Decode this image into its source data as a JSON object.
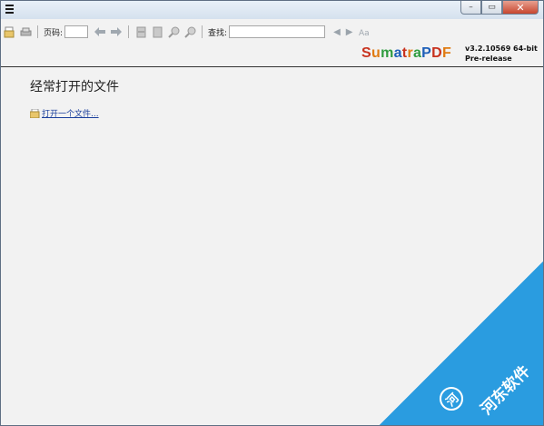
{
  "window": {
    "controls": {
      "minimize": "–",
      "maximize": "▭",
      "close": "✕"
    }
  },
  "toolbar": {
    "page_label": "页码:",
    "find_label": "查找:"
  },
  "app": {
    "name_parts": [
      {
        "text": "S",
        "color": "#c8321e"
      },
      {
        "text": "u",
        "color": "#e07b12"
      },
      {
        "text": "m",
        "color": "#2f9c3f"
      },
      {
        "text": "a",
        "color": "#1d5fb8"
      },
      {
        "text": "t",
        "color": "#c8321e"
      },
      {
        "text": "r",
        "color": "#e07b12"
      },
      {
        "text": "a",
        "color": "#2f9c3f"
      },
      {
        "text": "P",
        "color": "#1d5fb8"
      },
      {
        "text": "D",
        "color": "#c8321e"
      },
      {
        "text": "F",
        "color": "#e07b12"
      }
    ],
    "version_line1": "v3.2.10569 64-bit",
    "version_line2": "Pre-release"
  },
  "main": {
    "heading": "经常打开的文件",
    "open_link": "打开一个文件..."
  },
  "watermark": {
    "text": "河东软件",
    "color": "#2a9ce0"
  }
}
